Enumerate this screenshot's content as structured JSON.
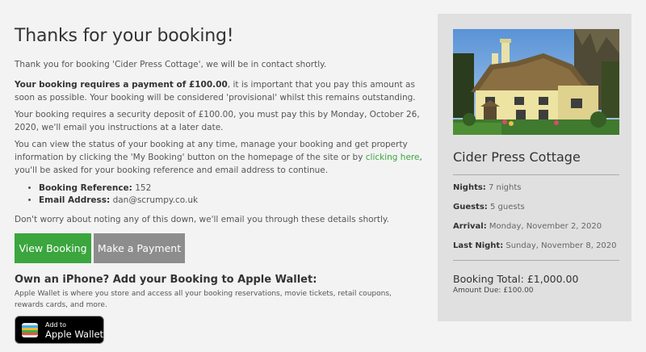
{
  "page": {
    "title": "Thanks for your booking!",
    "thanks_text": "Thank you for booking 'Cider Press Cottage', we will be in contact shortly.",
    "payment_bold": "Your booking requires a payment of £100.00",
    "payment_rest": ", it is important that you pay this amount as soon as possible. Your booking will be considered 'provisional' whilst this remains outstanding.",
    "deposit_text": "Your booking requires a security deposit of £100.00, you must pay this by Monday, October 26, 2020, we'll email you instructions at a later date.",
    "status_text_1": "You can view the status of your booking at any time, manage your booking and get property information by clicking the 'My Booking' button on the homepage of the site or by ",
    "status_link": "clicking here",
    "status_text_2": ", you'll be asked for your booking reference and email address to continue.",
    "ref_label": "Booking Reference:",
    "ref_value": "152",
    "email_label": "Email Address:",
    "email_value": "dan@scrumpy.co.uk",
    "note_text": "Don't worry about noting any of this down, we'll email you through these details shortly.",
    "view_booking_label": "View Booking",
    "make_payment_label": "Make a Payment",
    "wallet_heading": "Own an iPhone? Add your Booking to Apple Wallet:",
    "wallet_text": "Apple Wallet is where you store and access all your booking reservations, movie tickets, retail coupons, rewards cards, and more.",
    "wallet_button_small": "Add to",
    "wallet_button_big": "Apple Wallet"
  },
  "sidebar": {
    "property_name": "Cider Press Cottage",
    "nights_label": "Nights:",
    "nights_value": "7 nights",
    "guests_label": "Guests:",
    "guests_value": "5 guests",
    "arrival_label": "Arrival:",
    "arrival_value": "Monday, November 2, 2020",
    "lastnight_label": "Last Night:",
    "lastnight_value": "Sunday, November 8, 2020",
    "total_label": "Booking Total:",
    "total_value": "£1,000.00",
    "due_label": "Amount Due:",
    "due_value": "£100.00"
  },
  "colors": {
    "accent_green": "#3aa63d",
    "button_grey": "#8d8d8d",
    "sidebar_bg": "#e0e0e0",
    "page_bg": "#f3f3f3"
  }
}
